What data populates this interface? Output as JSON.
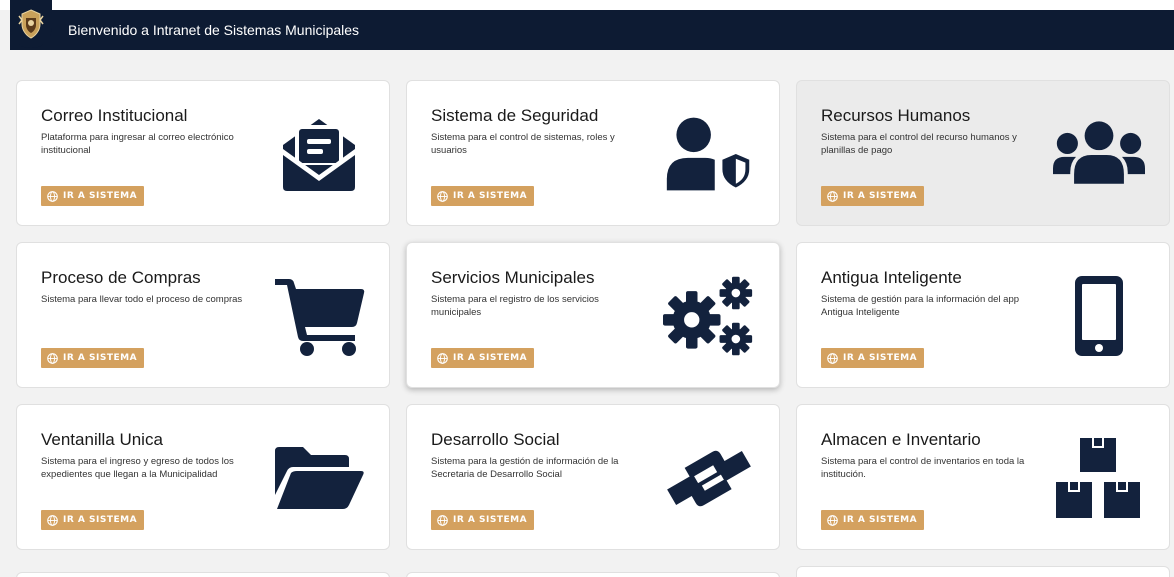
{
  "header": {
    "title": "Bienvenido a Intranet de Sistemas Municipales"
  },
  "cards": [
    {
      "title": "Correo Institucional",
      "description": "Plataforma para ingresar al correo electrónico institucional",
      "button": "IR A SISTEMA",
      "icon": "envelope-open-text-icon"
    },
    {
      "title": "Sistema de Seguridad",
      "description": "Sistema para el control de sistemas, roles y usuarios",
      "button": "IR A SISTEMA",
      "icon": "user-shield-icon"
    },
    {
      "title": "Recursos Humanos",
      "description": "Sistema para el control del recurso humanos y planillas de pago",
      "button": "IR A SISTEMA",
      "icon": "users-icon"
    },
    {
      "title": "Proceso de Compras",
      "description": "Sistema para llevar todo el proceso de compras",
      "button": "IR A SISTEMA",
      "icon": "shopping-cart-icon"
    },
    {
      "title": "Servicios Municipales",
      "description": "Sistema para el registro de los servicios municipales",
      "button": "IR A SISTEMA",
      "icon": "cogs-icon"
    },
    {
      "title": "Antigua Inteligente",
      "description": "Sistema de gestión para la información del app Antigua Inteligente",
      "button": "IR A SISTEMA",
      "icon": "mobile-phone-icon"
    },
    {
      "title": "Ventanilla Unica",
      "description": "Sistema para el ingreso y egreso de todos los expedientes que llegan a la Municipalidad",
      "button": "IR A SISTEMA",
      "icon": "folder-open-icon"
    },
    {
      "title": "Desarrollo Social",
      "description": "Sistema para la gestión de información de la Secretaria de Desarrollo Social",
      "button": "IR A SISTEMA",
      "icon": "handshake-icon"
    },
    {
      "title": "Almacen e Inventario",
      "description": "Sistema para el control de inventarios en toda la institución.",
      "button": "IR A SISTEMA",
      "icon": "boxes-icon"
    }
  ],
  "colors": {
    "navbar": "#0d1b33",
    "button": "#d4a15f",
    "icon": "#13223d"
  }
}
